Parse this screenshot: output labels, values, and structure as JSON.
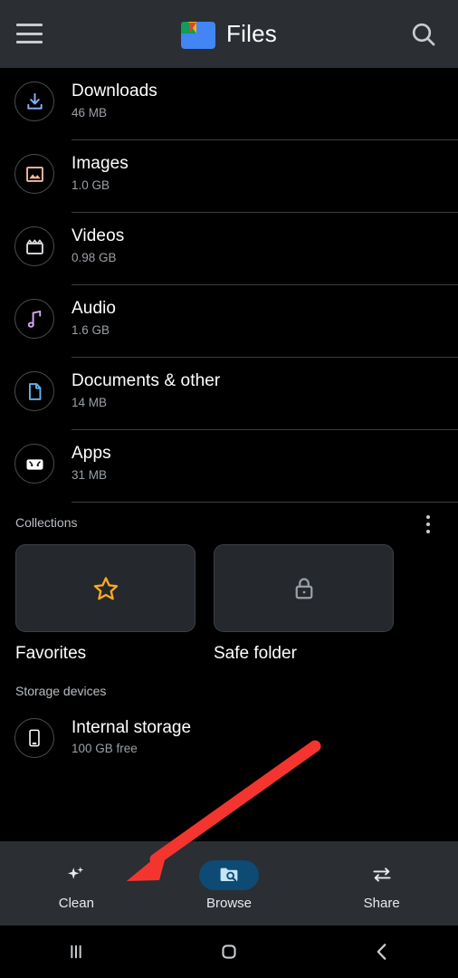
{
  "header": {
    "title": "Files",
    "menu_icon": "hamburger-menu-icon",
    "logo_icon": "google-files-logo",
    "search_icon": "search-icon"
  },
  "categories": [
    {
      "name": "Downloads",
      "size": "46 MB",
      "icon": "download-icon",
      "color": "#8ab4f8"
    },
    {
      "name": "Images",
      "size": "1.0 GB",
      "icon": "image-icon",
      "color": "#f2b8a6"
    },
    {
      "name": "Videos",
      "size": "0.98 GB",
      "icon": "video-icon",
      "color": "#dadce0"
    },
    {
      "name": "Audio",
      "size": "1.6 GB",
      "icon": "music-note-icon",
      "color": "#d7a9f5"
    },
    {
      "name": "Documents & other",
      "size": "14 MB",
      "icon": "document-icon",
      "color": "#5fb3e8"
    },
    {
      "name": "Apps",
      "size": "31 MB",
      "icon": "android-apps-icon",
      "color": "#ffffff"
    }
  ],
  "collections": {
    "label": "Collections",
    "overflow_icon": "more-vert-icon",
    "items": [
      {
        "label": "Favorites",
        "icon": "star-outline-icon",
        "color": "#f9a825"
      },
      {
        "label": "Safe folder",
        "icon": "lock-icon",
        "color": "#9aa0a6"
      }
    ]
  },
  "storage": {
    "label": "Storage devices",
    "items": [
      {
        "name": "Internal storage",
        "sub": "100 GB free",
        "icon": "phone-device-icon"
      }
    ]
  },
  "bottom_nav": {
    "active": "Browse",
    "active_color": "#0d4a74",
    "items": [
      {
        "label": "Clean",
        "icon": "sparkle-clean-icon",
        "active": false
      },
      {
        "label": "Browse",
        "icon": "folder-search-icon",
        "active": true
      },
      {
        "label": "Share",
        "icon": "swap-arrows-icon",
        "active": false
      }
    ]
  },
  "system_nav": {
    "items": [
      {
        "name": "recents",
        "icon": "recents-icon"
      },
      {
        "name": "home",
        "icon": "home-icon"
      },
      {
        "name": "back",
        "icon": "back-icon"
      }
    ]
  },
  "annotation": {
    "type": "arrow",
    "color": "#f4352f",
    "points_to": "Clean"
  }
}
